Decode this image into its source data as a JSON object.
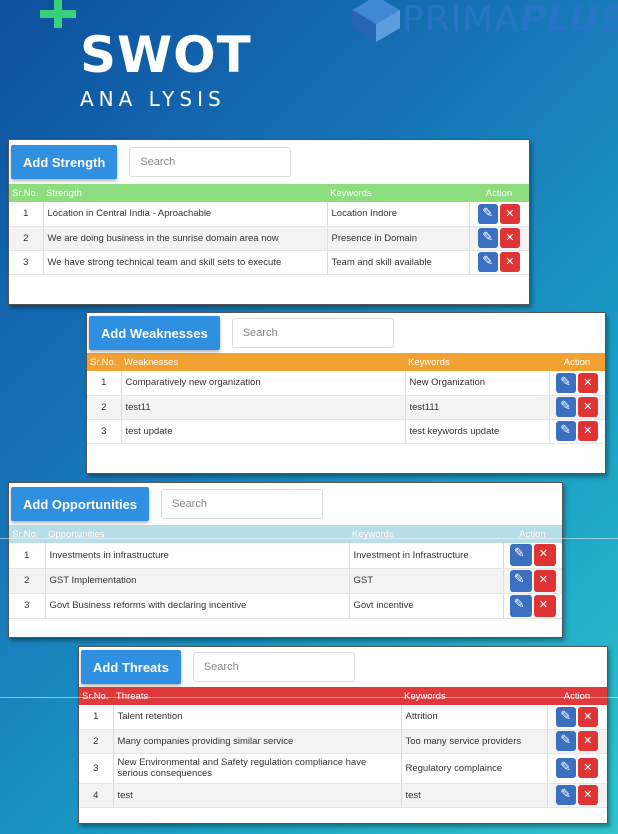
{
  "header": {
    "title": "SWOT",
    "subtitle": "ANA LYSIS",
    "brand_prima": "PRIMA",
    "brand_plus": "PLUS"
  },
  "colors": {
    "strength": "#8ddc7e",
    "weakness": "#f0a130",
    "opportunity": "#b7dde8",
    "threat": "#e0393c",
    "add_button": "#2f8fe0",
    "edit_button": "#3b6fbf",
    "delete_button": "#e03434"
  },
  "icons": {
    "edit": "pencil-icon",
    "delete": "close-icon",
    "brand": "cube-logo-icon",
    "plus": "plus-icon"
  },
  "strength": {
    "add_label": "Add Strength",
    "search_placeholder": "Search",
    "columns": [
      "Sr.No.",
      "Strength",
      "Keywords",
      "Action"
    ],
    "rows": [
      {
        "no": "1",
        "text": "Location in Central India - Aproachable",
        "keywords": "Location Indore"
      },
      {
        "no": "2",
        "text": "We are doing business in the sunrise domain area now",
        "keywords": "Presence in Domain"
      },
      {
        "no": "3",
        "text": "We have strong technical team and skill sets to execute",
        "keywords": "Team and skill available"
      }
    ]
  },
  "weakness": {
    "add_label": "Add Weaknesses",
    "search_placeholder": "Search",
    "columns": [
      "Sr.No.",
      "Weaknesses",
      "Keywords",
      "Action"
    ],
    "rows": [
      {
        "no": "1",
        "text": "Comparatively new organization",
        "keywords": "New Organization"
      },
      {
        "no": "2",
        "text": "test11",
        "keywords": "test111"
      },
      {
        "no": "3",
        "text": "test update",
        "keywords": "test keywords update"
      }
    ]
  },
  "opportunity": {
    "add_label": "Add Opportunities",
    "search_placeholder": "Search",
    "columns": [
      "Sr.No.",
      "Opportunities",
      "Keywords",
      "Action"
    ],
    "rows": [
      {
        "no": "1",
        "text": "Investments in infrastructure",
        "keywords": "Investment in Infrastructure"
      },
      {
        "no": "2",
        "text": "GST Implementation",
        "keywords": "GST"
      },
      {
        "no": "3",
        "text": "Govt Business reforms with declaring incentive",
        "keywords": "Govt incentive"
      }
    ]
  },
  "threat": {
    "add_label": "Add Threats",
    "search_placeholder": "Search",
    "columns": [
      "Sr.No.",
      "Threats",
      "Keywords",
      "Action"
    ],
    "rows": [
      {
        "no": "1",
        "text": "Talent retention",
        "keywords": "Attrition"
      },
      {
        "no": "2",
        "text": "Many companies providing similar service",
        "keywords": "Too many service providers"
      },
      {
        "no": "3",
        "text": "New Environmental and Safety regulation compliance have serious consequences",
        "keywords": "Regulatory complaince"
      },
      {
        "no": "4",
        "text": "test",
        "keywords": "test"
      }
    ]
  }
}
